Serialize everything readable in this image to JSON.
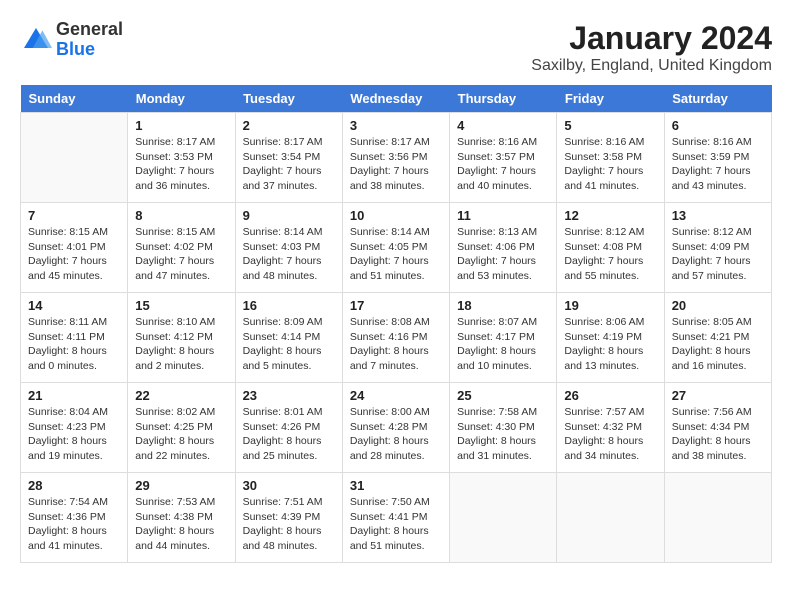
{
  "header": {
    "logo_general": "General",
    "logo_blue": "Blue",
    "month_title": "January 2024",
    "subtitle": "Saxilby, England, United Kingdom"
  },
  "weekdays": [
    "Sunday",
    "Monday",
    "Tuesday",
    "Wednesday",
    "Thursday",
    "Friday",
    "Saturday"
  ],
  "weeks": [
    [
      {
        "day": "",
        "info": ""
      },
      {
        "day": "1",
        "info": "Sunrise: 8:17 AM\nSunset: 3:53 PM\nDaylight: 7 hours\nand 36 minutes."
      },
      {
        "day": "2",
        "info": "Sunrise: 8:17 AM\nSunset: 3:54 PM\nDaylight: 7 hours\nand 37 minutes."
      },
      {
        "day": "3",
        "info": "Sunrise: 8:17 AM\nSunset: 3:56 PM\nDaylight: 7 hours\nand 38 minutes."
      },
      {
        "day": "4",
        "info": "Sunrise: 8:16 AM\nSunset: 3:57 PM\nDaylight: 7 hours\nand 40 minutes."
      },
      {
        "day": "5",
        "info": "Sunrise: 8:16 AM\nSunset: 3:58 PM\nDaylight: 7 hours\nand 41 minutes."
      },
      {
        "day": "6",
        "info": "Sunrise: 8:16 AM\nSunset: 3:59 PM\nDaylight: 7 hours\nand 43 minutes."
      }
    ],
    [
      {
        "day": "7",
        "info": "Sunrise: 8:15 AM\nSunset: 4:01 PM\nDaylight: 7 hours\nand 45 minutes."
      },
      {
        "day": "8",
        "info": "Sunrise: 8:15 AM\nSunset: 4:02 PM\nDaylight: 7 hours\nand 47 minutes."
      },
      {
        "day": "9",
        "info": "Sunrise: 8:14 AM\nSunset: 4:03 PM\nDaylight: 7 hours\nand 48 minutes."
      },
      {
        "day": "10",
        "info": "Sunrise: 8:14 AM\nSunset: 4:05 PM\nDaylight: 7 hours\nand 51 minutes."
      },
      {
        "day": "11",
        "info": "Sunrise: 8:13 AM\nSunset: 4:06 PM\nDaylight: 7 hours\nand 53 minutes."
      },
      {
        "day": "12",
        "info": "Sunrise: 8:12 AM\nSunset: 4:08 PM\nDaylight: 7 hours\nand 55 minutes."
      },
      {
        "day": "13",
        "info": "Sunrise: 8:12 AM\nSunset: 4:09 PM\nDaylight: 7 hours\nand 57 minutes."
      }
    ],
    [
      {
        "day": "14",
        "info": "Sunrise: 8:11 AM\nSunset: 4:11 PM\nDaylight: 8 hours\nand 0 minutes."
      },
      {
        "day": "15",
        "info": "Sunrise: 8:10 AM\nSunset: 4:12 PM\nDaylight: 8 hours\nand 2 minutes."
      },
      {
        "day": "16",
        "info": "Sunrise: 8:09 AM\nSunset: 4:14 PM\nDaylight: 8 hours\nand 5 minutes."
      },
      {
        "day": "17",
        "info": "Sunrise: 8:08 AM\nSunset: 4:16 PM\nDaylight: 8 hours\nand 7 minutes."
      },
      {
        "day": "18",
        "info": "Sunrise: 8:07 AM\nSunset: 4:17 PM\nDaylight: 8 hours\nand 10 minutes."
      },
      {
        "day": "19",
        "info": "Sunrise: 8:06 AM\nSunset: 4:19 PM\nDaylight: 8 hours\nand 13 minutes."
      },
      {
        "day": "20",
        "info": "Sunrise: 8:05 AM\nSunset: 4:21 PM\nDaylight: 8 hours\nand 16 minutes."
      }
    ],
    [
      {
        "day": "21",
        "info": "Sunrise: 8:04 AM\nSunset: 4:23 PM\nDaylight: 8 hours\nand 19 minutes."
      },
      {
        "day": "22",
        "info": "Sunrise: 8:02 AM\nSunset: 4:25 PM\nDaylight: 8 hours\nand 22 minutes."
      },
      {
        "day": "23",
        "info": "Sunrise: 8:01 AM\nSunset: 4:26 PM\nDaylight: 8 hours\nand 25 minutes."
      },
      {
        "day": "24",
        "info": "Sunrise: 8:00 AM\nSunset: 4:28 PM\nDaylight: 8 hours\nand 28 minutes."
      },
      {
        "day": "25",
        "info": "Sunrise: 7:58 AM\nSunset: 4:30 PM\nDaylight: 8 hours\nand 31 minutes."
      },
      {
        "day": "26",
        "info": "Sunrise: 7:57 AM\nSunset: 4:32 PM\nDaylight: 8 hours\nand 34 minutes."
      },
      {
        "day": "27",
        "info": "Sunrise: 7:56 AM\nSunset: 4:34 PM\nDaylight: 8 hours\nand 38 minutes."
      }
    ],
    [
      {
        "day": "28",
        "info": "Sunrise: 7:54 AM\nSunset: 4:36 PM\nDaylight: 8 hours\nand 41 minutes."
      },
      {
        "day": "29",
        "info": "Sunrise: 7:53 AM\nSunset: 4:38 PM\nDaylight: 8 hours\nand 44 minutes."
      },
      {
        "day": "30",
        "info": "Sunrise: 7:51 AM\nSunset: 4:39 PM\nDaylight: 8 hours\nand 48 minutes."
      },
      {
        "day": "31",
        "info": "Sunrise: 7:50 AM\nSunset: 4:41 PM\nDaylight: 8 hours\nand 51 minutes."
      },
      {
        "day": "",
        "info": ""
      },
      {
        "day": "",
        "info": ""
      },
      {
        "day": "",
        "info": ""
      }
    ]
  ]
}
